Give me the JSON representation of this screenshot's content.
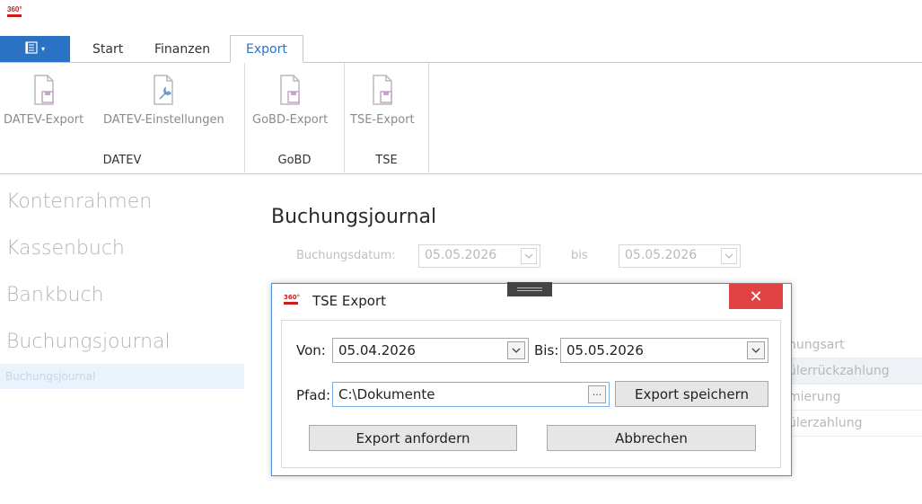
{
  "app": {
    "logo_text": "360°"
  },
  "ribbon": {
    "app_menu_icon": "document-list-icon",
    "tabs": [
      {
        "label": "Start"
      },
      {
        "label": "Finanzen"
      },
      {
        "label": "Export"
      }
    ],
    "groups": [
      {
        "label": "DATEV",
        "buttons": [
          {
            "label": "DATEV-Export",
            "icon": "document-export-icon"
          },
          {
            "label": "DATEV-Einstellungen",
            "icon": "document-settings-icon"
          }
        ]
      },
      {
        "label": "GoBD",
        "buttons": [
          {
            "label": "GoBD-Export",
            "icon": "document-export-icon"
          }
        ]
      },
      {
        "label": "TSE",
        "buttons": [
          {
            "label": "TSE-Export",
            "icon": "document-export-icon"
          }
        ]
      }
    ]
  },
  "sidebar": {
    "items": [
      {
        "label": "Kontenrahmen"
      },
      {
        "label": "Kassenbuch"
      },
      {
        "label": "Bankbuch"
      },
      {
        "label": "Buchungsjournal"
      }
    ],
    "selected_sub": "Buchungsjournal"
  },
  "content": {
    "title": "Buchungsjournal",
    "filter": {
      "date_label": "Buchungsdatum:",
      "from": "05.05.2026",
      "to_label": "bis",
      "to": "05.05.2026"
    },
    "grid_fragments": [
      "hungsart",
      "ülerrückzahlung",
      "mierung",
      "ülerzahlung"
    ]
  },
  "dialog": {
    "title": "TSE Export",
    "close_label": "✕",
    "von_label": "Von:",
    "von_value": "05.04.2026",
    "bis_label": "Bis:",
    "bis_value": "05.05.2026",
    "pfad_label": "Pfad:",
    "pfad_value": "C:\\Dokumente",
    "browse_label": "···",
    "save_button": "Export speichern",
    "request_button": "Export anfordern",
    "cancel_button": "Abbrechen"
  }
}
